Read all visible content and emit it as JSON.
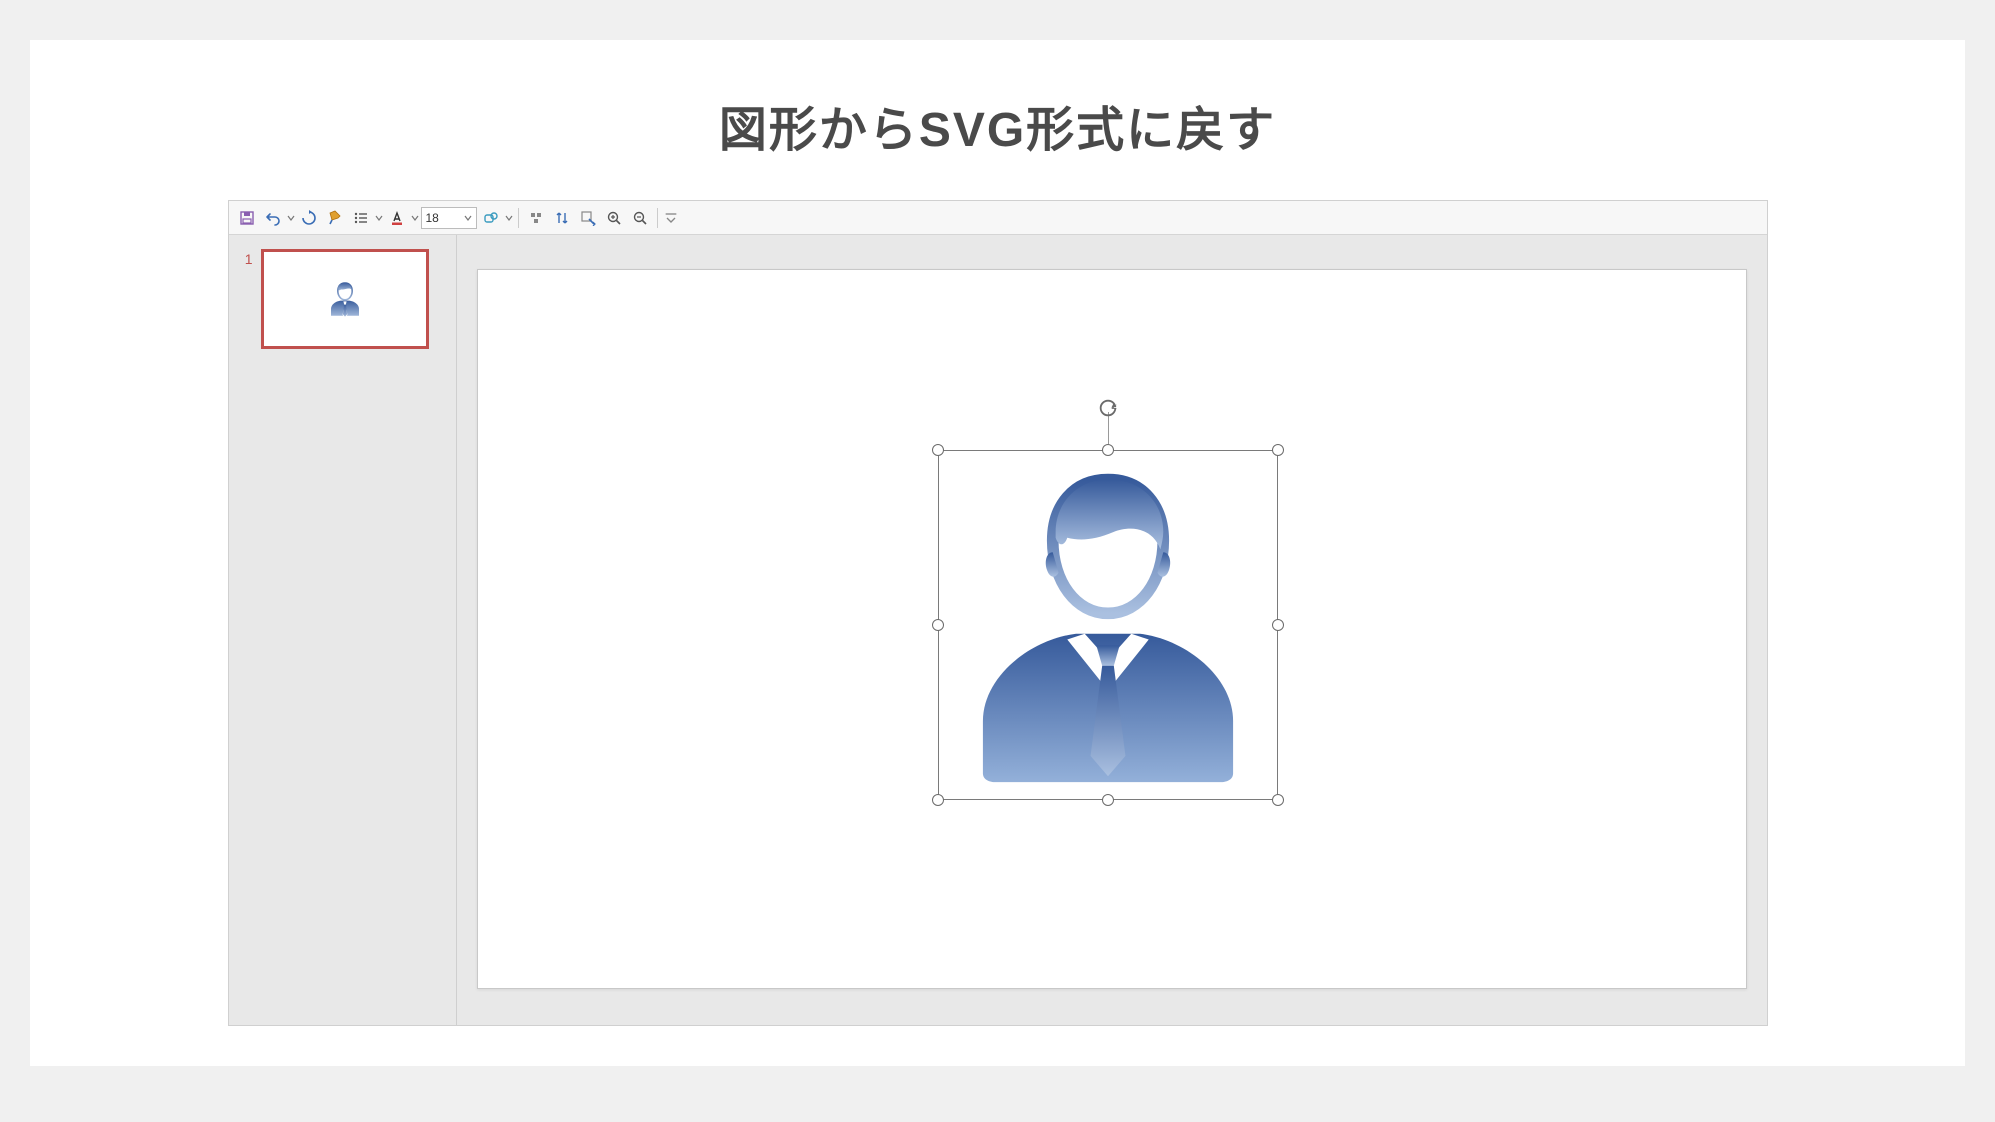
{
  "page": {
    "title": "図形からSVG形式に戻す"
  },
  "toolbar": {
    "save": "save",
    "undo": "undo",
    "redo": "redo",
    "format_painter": "format-painter",
    "bullets": "bullets",
    "font_color": "font-color",
    "font_size_value": "18",
    "shapes": "shapes",
    "align": "align",
    "arrange": "arrange",
    "ruler": "ruler",
    "zoom_in": "zoom-in",
    "zoom_out": "zoom-out",
    "overflow": "more"
  },
  "slides": {
    "items": [
      {
        "number": "1",
        "selected": true,
        "content_icon": "businessman-icon"
      }
    ]
  },
  "canvas": {
    "selected_shape": {
      "name": "businessman-icon",
      "has_rotation_handle": true
    }
  }
}
